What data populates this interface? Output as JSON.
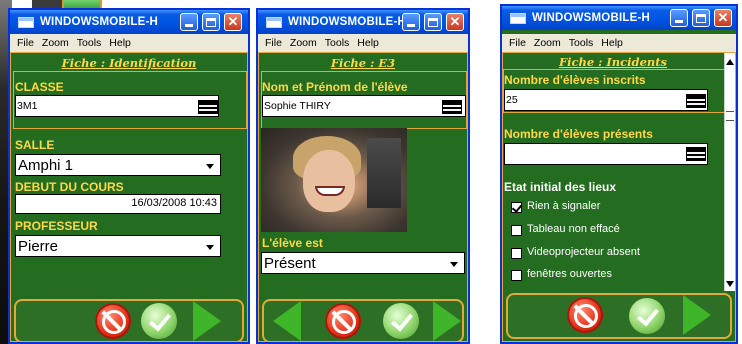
{
  "window": {
    "title": "WINDOWSMOBILE-H",
    "menu": [
      "File",
      "Zoom",
      "Tools",
      "Help"
    ]
  },
  "screen1": {
    "heading": "Fiche : Identification",
    "classe_label": "CLASSE",
    "classe_value": "3M1",
    "salle_label": "SALLE",
    "salle_value": "Amphi 1",
    "debut_label": "DEBUT  DU COURS",
    "debut_value": "16/03/2008 10:43",
    "prof_label": "PROFESSEUR",
    "prof_value": "Pierre"
  },
  "screen2": {
    "heading": "Fiche : E3",
    "name_label": "Nom et Prénom de l'élève",
    "name_value": "Sophie THIRY",
    "status_label": "L'élève est",
    "status_value": "Présent"
  },
  "screen3": {
    "heading": "Fiche : Incidents",
    "inscrits_label": "Nombre d'élèves inscrits",
    "inscrits_value": "25",
    "presents_label": "Nombre d'élèves présents",
    "presents_value": "",
    "etat_label": "Etat initial des lieux",
    "options": [
      {
        "label": "Rien à signaler",
        "checked": true
      },
      {
        "label": "Tableau non effacé",
        "checked": false
      },
      {
        "label": "Videoprojecteur absent",
        "checked": false
      },
      {
        "label": "fenêtres ouvertes",
        "checked": false
      }
    ]
  },
  "colors": {
    "panel_green": "#246c1f",
    "label_yellow": "#ffd84a",
    "frame_orange": "#e2a93a",
    "titlebar_blue": "#0054e3"
  },
  "icons": [
    "windows-icon",
    "minimize-icon",
    "maximize-icon",
    "close-icon",
    "keyboard-icon",
    "dropdown-arrow-icon",
    "stop-icon",
    "checkmark-icon",
    "next-arrow-icon",
    "back-arrow-icon"
  ]
}
